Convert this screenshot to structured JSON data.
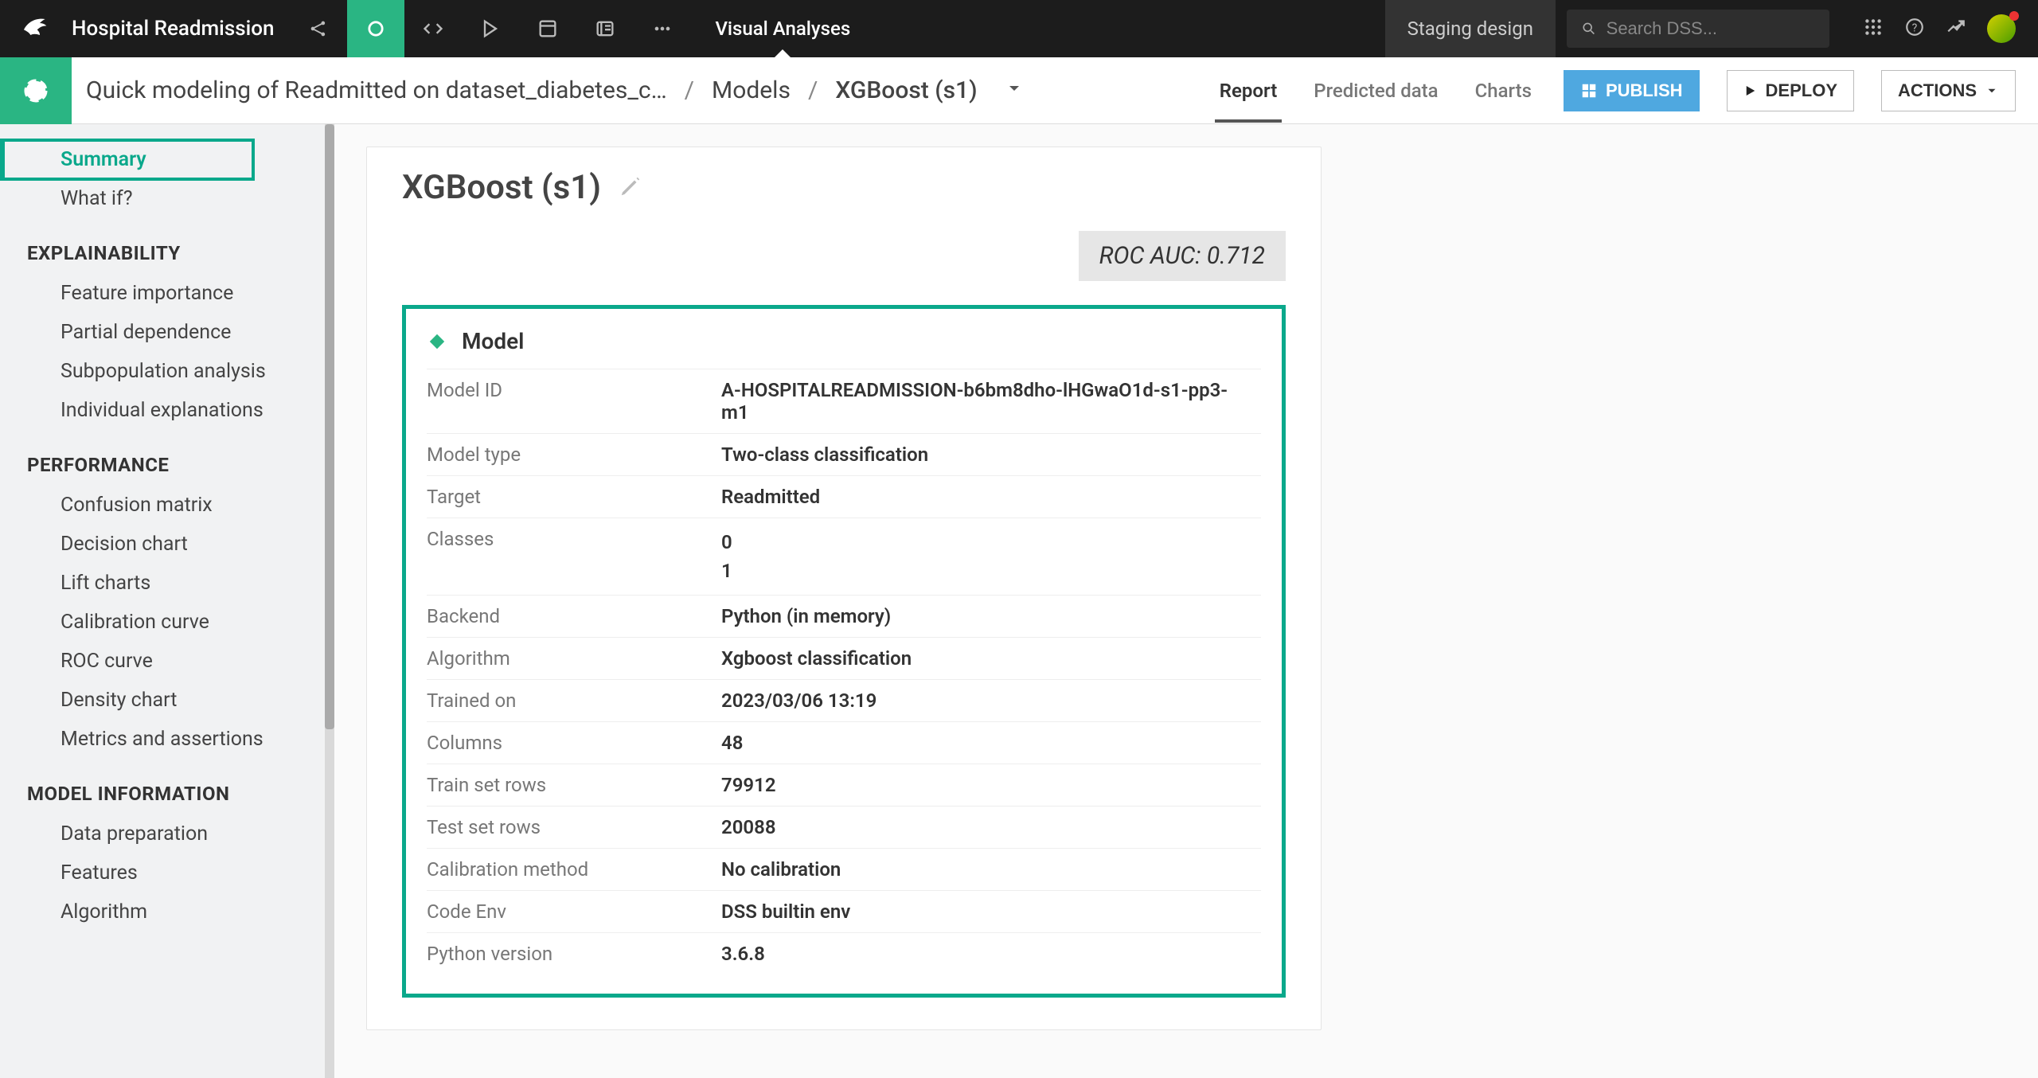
{
  "topbar": {
    "project": "Hospital Readmission",
    "visual_analyses": "Visual Analyses",
    "staging": "Staging design",
    "search_placeholder": "Search DSS..."
  },
  "breadcrumbs": {
    "analysis": "Quick modeling of Readmitted on dataset_diabetes_c…",
    "models": "Models",
    "model": "XGBoost (s1)"
  },
  "tabs": {
    "report": "Report",
    "predicted": "Predicted data",
    "charts": "Charts",
    "publish": "PUBLISH",
    "deploy": "DEPLOY",
    "actions": "ACTIONS"
  },
  "sidebar": {
    "summary": "Summary",
    "what_if": "What if?",
    "sec_explainability": "EXPLAINABILITY",
    "feature_importance": "Feature importance",
    "partial_dependence": "Partial dependence",
    "subpopulation": "Subpopulation analysis",
    "individual_expl": "Individual explanations",
    "sec_performance": "PERFORMANCE",
    "confusion": "Confusion matrix",
    "decision_chart": "Decision chart",
    "lift": "Lift charts",
    "calibration": "Calibration curve",
    "roc": "ROC curve",
    "density": "Density chart",
    "metrics": "Metrics and assertions",
    "sec_model_info": "MODEL INFORMATION",
    "data_prep": "Data preparation",
    "features": "Features",
    "algorithm": "Algorithm"
  },
  "panel": {
    "title": "XGBoost (s1)",
    "metric_label": "ROC AUC: 0.712",
    "model_section": "Model",
    "rows": {
      "model_id_k": "Model ID",
      "model_id_v": "A-HOSPITALREADMISSION-b6bm8dho-lHGwaO1d-s1-pp3-m1",
      "model_type_k": "Model type",
      "model_type_v": "Two-class classification",
      "target_k": "Target",
      "target_v": "Readmitted",
      "classes_k": "Classes",
      "classes_v1": "0",
      "classes_v2": "1",
      "backend_k": "Backend",
      "backend_v": "Python (in memory)",
      "algorithm_k": "Algorithm",
      "algorithm_v": "Xgboost classification",
      "trained_on_k": "Trained on",
      "trained_on_v": "2023/03/06 13:19",
      "columns_k": "Columns",
      "columns_v": "48",
      "train_rows_k": "Train set rows",
      "train_rows_v": "79912",
      "test_rows_k": "Test set rows",
      "test_rows_v": "20088",
      "calibration_k": "Calibration method",
      "calibration_v": "No calibration",
      "code_env_k": "Code Env",
      "code_env_v": "DSS builtin env",
      "python_k": "Python version",
      "python_v": "3.6.8"
    }
  }
}
